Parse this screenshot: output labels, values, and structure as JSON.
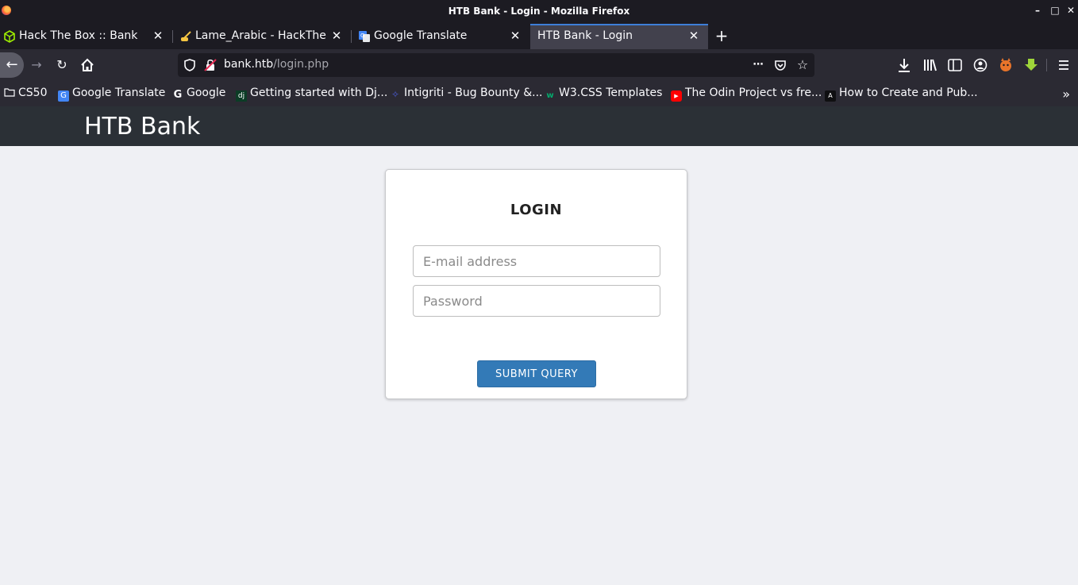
{
  "window": {
    "title": "HTB Bank - Login - Mozilla Firefox",
    "controls": [
      "minimize",
      "maximize",
      "close"
    ]
  },
  "tabs": [
    {
      "label": "Hack The Box :: Bank",
      "icon": "hackthebox-cube-icon",
      "active": false
    },
    {
      "label": "Lame_Arabic - HackTheB",
      "icon": "pencil-hand-icon",
      "active": false
    },
    {
      "label": "Google Translate",
      "icon": "google-translate-icon",
      "active": false
    },
    {
      "label": "HTB Bank - Login",
      "icon": "none",
      "active": true
    }
  ],
  "navbar": {
    "url_host": "bank.htb",
    "url_path": "/login.php"
  },
  "bookmarks": [
    {
      "label": "CS50",
      "icon": "folder-icon"
    },
    {
      "label": "Google Translate",
      "icon": "google-translate-icon"
    },
    {
      "label": "Google",
      "icon": "google-icon"
    },
    {
      "label": "Getting started with Dj...",
      "icon": "django-icon"
    },
    {
      "label": "Intigriti - Bug Bounty &...",
      "icon": "intigriti-icon"
    },
    {
      "label": "W3.CSS Templates",
      "icon": "w3-icon"
    },
    {
      "label": "The Odin Project vs fre...",
      "icon": "youtube-icon"
    },
    {
      "label": "How to Create and Pub...",
      "icon": "angular-icon"
    }
  ],
  "page": {
    "brand": "HTB Bank",
    "login": {
      "heading": "LOGIN",
      "email_placeholder": "E-mail address",
      "password_placeholder": "Password",
      "submit_label": "SUBMIT QUERY"
    }
  },
  "colors": {
    "accent": "#337ab7",
    "header_bg": "#2b3036",
    "page_bg": "#eff0f4",
    "active_tab_line": "#3d7ed8"
  }
}
